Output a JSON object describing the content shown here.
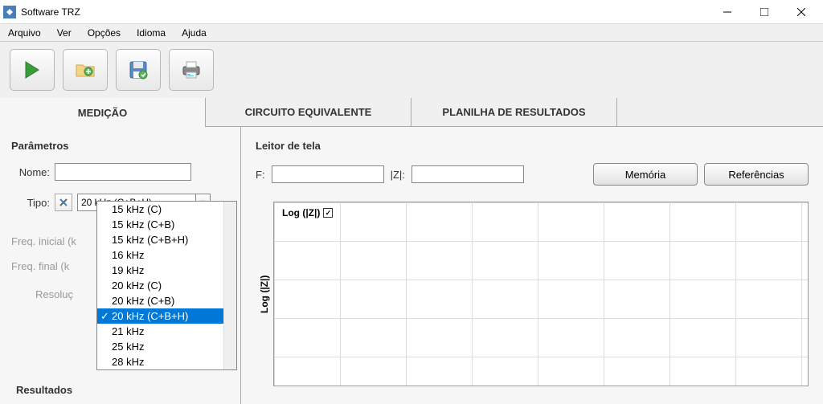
{
  "window": {
    "title": "Software TRZ"
  },
  "menu": {
    "arquivo": "Arquivo",
    "ver": "Ver",
    "opcoes": "Opções",
    "idioma": "Idioma",
    "ajuda": "Ajuda"
  },
  "tabs": {
    "medicao": "MEDIÇÃO",
    "circuito": "CIRCUITO EQUIVALENTE",
    "planilha": "PLANILHA DE RESULTADOS"
  },
  "parametros": {
    "title": "Parâmetros",
    "nome_label": "Nome:",
    "nome_value": "",
    "tipo_label": "Tipo:",
    "tipo_value": "20 kHz (C+B+H)",
    "freq_inicial_label": "Freq. inicial (k",
    "freq_final_label": "Freq. final (k",
    "resolucao_label": "Resoluç",
    "dropdown_options": [
      {
        "label": "15 kHz (C)",
        "selected": false
      },
      {
        "label": "15 kHz (C+B)",
        "selected": false
      },
      {
        "label": "15 kHz (C+B+H)",
        "selected": false
      },
      {
        "label": "16 kHz",
        "selected": false
      },
      {
        "label": "19 kHz",
        "selected": false
      },
      {
        "label": "20 kHz (C)",
        "selected": false
      },
      {
        "label": "20 kHz (C+B)",
        "selected": false
      },
      {
        "label": "20 kHz (C+B+H)",
        "selected": true
      },
      {
        "label": "21 kHz",
        "selected": false
      },
      {
        "label": "25 kHz",
        "selected": false
      },
      {
        "label": "28 kHz",
        "selected": false
      }
    ]
  },
  "resultados": {
    "title": "Resultados"
  },
  "leitor": {
    "title": "Leitor de tela",
    "f_label": "F:",
    "f_value": "",
    "z_label": "|Z|:",
    "z_value": ""
  },
  "buttons": {
    "memoria": "Memória",
    "referencias": "Referências"
  },
  "chart": {
    "y_label": "Log (|Z|)",
    "legend": "Log (|Z|)"
  }
}
